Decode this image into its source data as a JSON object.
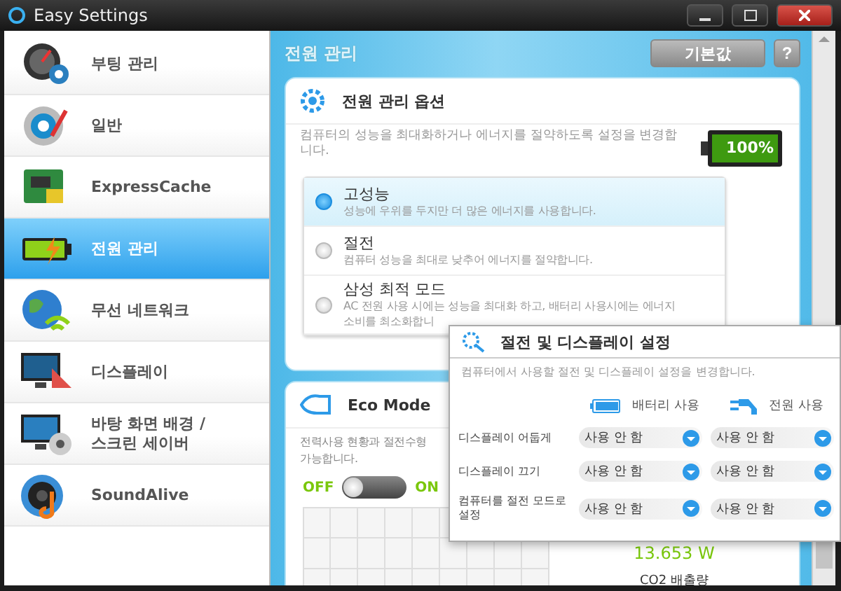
{
  "window": {
    "title": "Easy Settings"
  },
  "sidebar": {
    "items": [
      {
        "label": "부팅 관리",
        "selected": false
      },
      {
        "label": "일반",
        "selected": false
      },
      {
        "label": "ExpressCache",
        "selected": false
      },
      {
        "label": "전원 관리",
        "selected": true
      },
      {
        "label": "무선 네트워크",
        "selected": false
      },
      {
        "label": "디스플레이",
        "selected": false
      },
      {
        "label": "바탕 화면 배경 / 스크린 세이버",
        "selected": false
      },
      {
        "label": "SoundAlive",
        "selected": false
      }
    ]
  },
  "header": {
    "title": "전원 관리",
    "default_button": "기본값",
    "help_button": "?"
  },
  "power_options": {
    "title": "전원 관리 옵션",
    "description": "컴퓨터의 성능을 최대화하거나 에너지를 절약하도록 설정을 변경합니다.",
    "battery_label": "100%",
    "options": [
      {
        "name": "고성능",
        "description_lines": [
          "성능에 우위를 두지만 더 많은 에너지를 사용합니다."
        ],
        "selected": true
      },
      {
        "name": "절전",
        "description_lines": [
          "컴퓨터 성능을 최대로 낮추어 에너지를 절약합니다."
        ],
        "selected": false
      },
      {
        "name": "삼성 최적 모드",
        "description_lines": [
          "AC 전원 사용 시에는 성능을 최대화 하고, 배터리 사용시에는 에너지",
          "소비를 최소화합니"
        ],
        "selected": false
      }
    ]
  },
  "eco_mode": {
    "title": "Eco Mode",
    "description_lines": [
      "전력사용 현황과 절전수형",
      "가능합니다."
    ],
    "off_label": "OFF",
    "on_label": "ON",
    "on": false,
    "power_reading": "13.653 W",
    "co2_label": "CO2 배출량"
  },
  "sleep_display": {
    "title": "절전 및 디스플레이 설정",
    "description": "컴퓨터에서 사용할 절전 및 디스플레이 설정을 변경합니다.",
    "columns": [
      "배터리 사용",
      "전원 사용"
    ],
    "rows": [
      {
        "label": "디스플레이 어둡게",
        "values": [
          "사용 안 함",
          "사용 안 함"
        ]
      },
      {
        "label": "디스플레이 끄기",
        "values": [
          "사용 안 함",
          "사용 안 함"
        ]
      },
      {
        "label": "컴퓨터를 절전 모드로 설정",
        "values": [
          "사용 안 함",
          "사용 안 함"
        ]
      }
    ]
  }
}
